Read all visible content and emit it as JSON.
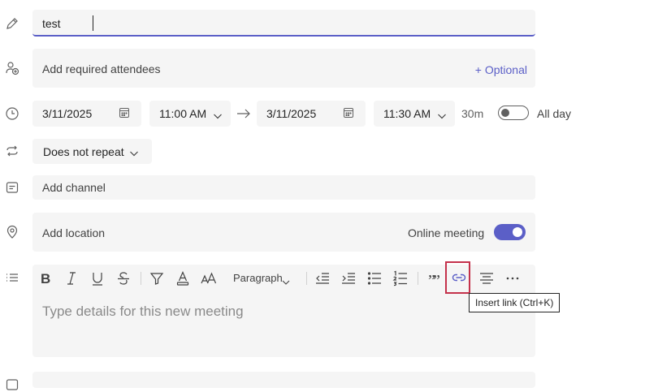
{
  "title": {
    "value": "test"
  },
  "attendees": {
    "placeholder": "Add required attendees",
    "optional_label": "+ Optional"
  },
  "datetime": {
    "start_date": "3/11/2025",
    "start_time": "11:00 AM",
    "end_date": "3/11/2025",
    "end_time": "11:30 AM",
    "duration": "30m",
    "all_day_label": "All day",
    "all_day_on": false
  },
  "repeat": {
    "value": "Does not repeat"
  },
  "channel": {
    "placeholder": "Add channel"
  },
  "location": {
    "placeholder": "Add location",
    "online_meeting_label": "Online meeting",
    "online_meeting_on": true
  },
  "editor": {
    "paragraph_label": "Paragraph",
    "placeholder": "Type details for this new meeting",
    "tooltip": "Insert link (Ctrl+K)"
  },
  "colors": {
    "accent": "#5b5fc7",
    "highlight_border": "#c4314b",
    "field_bg": "#f5f5f5"
  }
}
